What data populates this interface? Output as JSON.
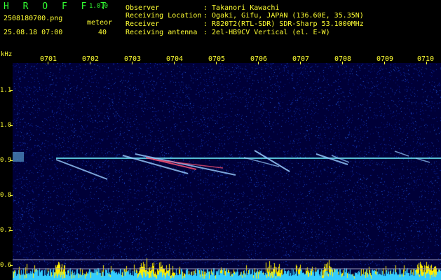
{
  "header": {
    "app_name": "H R O F F T",
    "version": "1.0.0",
    "filename": "2508180700.png",
    "meteor_label": "meteor",
    "datetime": "25.08.18 07:00",
    "meteor_count": "40",
    "info_lines": [
      {
        "label": "Observer",
        "value": ": Takanori Kawachi"
      },
      {
        "label": "Receiving Location",
        "value": ": Ogaki, Gifu, JAPAN (136.60E, 35.35N)"
      },
      {
        "label": "Receiver",
        "value": ": R820T2(RTL-SDR) SDR-Sharp 53.1000MHz"
      },
      {
        "label": "Receiving antenna",
        "value": ": 2el-HB9CV Vertical (el. E-W)"
      }
    ]
  },
  "plot": {
    "y_unit": "kHz",
    "y_ticks": [
      "1.1",
      "1.0",
      "0.9",
      "0.8",
      "0.7",
      "0.6"
    ],
    "x_ticks": [
      "0701",
      "0702",
      "0703",
      "0704",
      "0705",
      "0706",
      "0707",
      "0708",
      "0709",
      "0710"
    ],
    "colors": {
      "background": "#000038",
      "axis_text": "#ffff33",
      "title": "#33ff33",
      "carrier": "#66ddee",
      "meteor": "#99ccff",
      "strong_meteor": "#ff5577",
      "floor_cyan": "#33ccff",
      "floor_yellow": "#ffee00"
    }
  }
}
